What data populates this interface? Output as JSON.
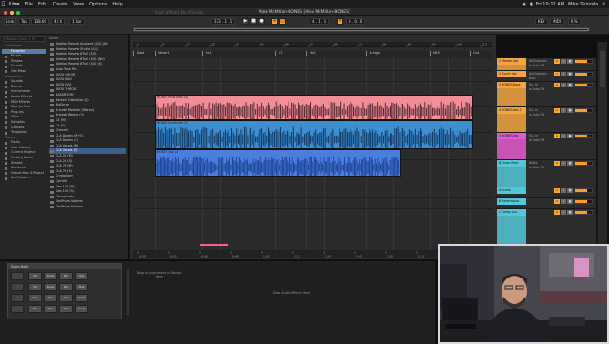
{
  "menubar": {
    "apple": "",
    "items": [
      "Live",
      "File",
      "Edit",
      "Create",
      "View",
      "Options",
      "Help"
    ],
    "clock": "Fri 10:12 AM",
    "user": "Mike Shinoda"
  },
  "window": {
    "title": "Alex McMillan-BONES  [Alex McMillan-BONES]",
    "ghost_title": "Flash Without Me #Serrato"
  },
  "transport": {
    "link": "Link",
    "tap": "Tap",
    "tempo": "138.00",
    "meter": "4 / 4",
    "metro": "1 Bar",
    "position": "233 . 1 . 1",
    "loop_start": "4 . 1 . 1",
    "loop_len": "8 . 0 . 0",
    "key": "KEY",
    "midi": "MIDI",
    "cpu": "6 %"
  },
  "browser": {
    "search_placeholder": "Search (Cmd + F)",
    "column_name": "Name",
    "categories": [
      {
        "label": "Collections",
        "type": "hdr"
      },
      {
        "label": "Favorites",
        "type": "item"
      },
      {
        "label": "Purple",
        "type": "item"
      },
      {
        "label": "Shakes",
        "type": "item"
      },
      {
        "label": "Sounds",
        "type": "item"
      },
      {
        "label": "Use Moon",
        "type": "item"
      },
      {
        "label": "Categories",
        "type": "hdr"
      },
      {
        "label": "Sounds",
        "type": "item"
      },
      {
        "label": "Drums",
        "type": "item"
      },
      {
        "label": "Instruments",
        "type": "item"
      },
      {
        "label": "Audio Effects",
        "type": "item"
      },
      {
        "label": "MIDI Effects",
        "type": "item"
      },
      {
        "label": "Max for Live",
        "type": "item"
      },
      {
        "label": "Plug-ins",
        "type": "item"
      },
      {
        "label": "Clips",
        "type": "item"
      },
      {
        "label": "Samples",
        "type": "item"
      },
      {
        "label": "Grooves",
        "type": "item"
      },
      {
        "label": "Templates",
        "type": "item"
      },
      {
        "label": "Places",
        "type": "hdr"
      },
      {
        "label": "Packs",
        "type": "item"
      },
      {
        "label": "User Library",
        "type": "item"
      },
      {
        "label": "Current Project",
        "type": "item"
      },
      {
        "label": "Factory Packs",
        "type": "item"
      },
      {
        "label": "Shared",
        "type": "item"
      },
      {
        "label": "Seeds Lib",
        "type": "item"
      },
      {
        "label": "Virtual Mac 4 Project",
        "type": "item"
      },
      {
        "label": "Add Folder...",
        "type": "item"
      }
    ],
    "files": [
      {
        "label": "Ableton Reverb Ambient (S/S) (Ne",
        "sel": false
      },
      {
        "label": "Ableton Reverb Studio (S/S)",
        "sel": false
      },
      {
        "label": "Ableton Reverb 8Trail (S/S)",
        "sel": false
      },
      {
        "label": "Ableton Reverb 8Trail (S/S) (Ne)",
        "sel": false
      },
      {
        "label": "Ableton Reverb 8Trail (S/S) (S)",
        "sel": false
      },
      {
        "label": "Auto Tune Pro",
        "sel": false
      },
      {
        "label": "AVOX CHOIR",
        "sel": false
      },
      {
        "label": "AVOX DUO",
        "sel": false
      },
      {
        "label": "AVOX EVO",
        "sel": false
      },
      {
        "label": "AVOX THROAT",
        "sel": false
      },
      {
        "label": "BASSROOM",
        "sel": false
      },
      {
        "label": "Berserk Distortion (S)",
        "sel": false
      },
      {
        "label": "BigDrum",
        "sel": false
      },
      {
        "label": "Bricasti Moduler (Stereo)",
        "sel": false
      },
      {
        "label": "Bricasti Worlds (S)",
        "sel": false
      },
      {
        "label": "C4 (M)",
        "sel": false
      },
      {
        "label": "C4 (S)",
        "sel": false
      },
      {
        "label": "Channel",
        "sel": false
      },
      {
        "label": "CLA Drums (M+S)",
        "sel": false
      },
      {
        "label": "CLA Drums (S)",
        "sel": false
      },
      {
        "label": "CLA Vocals (M)",
        "sel": false
      },
      {
        "label": "CLA Vocals (S)",
        "sel": false
      },
      {
        "label": "CLA 2A (M)",
        "sel": false
      },
      {
        "label": "CLA 2A (S)",
        "sel": false
      },
      {
        "label": "CLA 76 (M)",
        "sel": false
      },
      {
        "label": "CLA 76 (S)",
        "sel": false
      },
      {
        "label": "Crystallizer",
        "sel": false
      },
      {
        "label": "CymVol",
        "sel": false
      },
      {
        "label": "Dec 140 (M)",
        "sel": false
      },
      {
        "label": "Dec 140 (S)",
        "sel": false
      },
      {
        "label": "DecapAudio",
        "sel": false
      },
      {
        "label": "DecPrism Volume",
        "sel": false
      },
      {
        "label": "DecPrism Volume",
        "sel": false
      }
    ],
    "selected_index": 21
  },
  "locators": [
    {
      "label": "Start"
    },
    {
      "label": "Verse 1"
    },
    {
      "label": "Hk1"
    },
    {
      "label": "V2"
    },
    {
      "label": "Hk2"
    },
    {
      "label": "Bridge"
    },
    {
      "label": "Hk3"
    },
    {
      "label": "Out"
    }
  ],
  "ruler_ticks": [
    "1",
    "9",
    "17",
    "25",
    "33",
    "41",
    "49",
    "57",
    "65",
    "73",
    "81",
    "89",
    "97",
    "105",
    "113"
  ],
  "time_ticks": [
    "0:00",
    "0:15",
    "0:30",
    "0:45",
    "1:00",
    "1:15",
    "1:30",
    "1:45",
    "2:00",
    "2:15",
    "2:30",
    "2:45"
  ],
  "clips": [
    {
      "name": "BONES Final Bass (4)",
      "color": "#f18f99"
    },
    {
      "name": "BONES Synth Vox (3)",
      "color": "#3e8fd1"
    },
    {
      "name": "BONES Vox (4)",
      "color": "#4a7dde"
    }
  ],
  "tracks": [
    {
      "name": "1 Master Vox",
      "color": "#f2a540",
      "input": "All Channels",
      "mode": "In Auto Off",
      "vol": "0"
    },
    {
      "name": "2 Synth Vox",
      "color": "#f2a540",
      "input": "All Channels",
      "mode": "Auto",
      "vol": "0"
    },
    {
      "name": "3 BONES Bass",
      "color": "#f2a540",
      "input": "Ext. In",
      "mode": "In Auto Off",
      "vol": "0"
    },
    {
      "name": "4 BONES Vox 2",
      "color": "#f2a540",
      "input": "Ext. In",
      "mode": "In Auto Off",
      "vol": "0"
    },
    {
      "name": "5 BONES Vox",
      "color": "#e35bd0",
      "input": "Ext. In",
      "mode": "In Auto Off",
      "vol": "0"
    },
    {
      "name": "6 Drum Rack",
      "color": "#53c6d8",
      "input": "All Ins",
      "mode": "In Auto Off",
      "vol": "0"
    },
    {
      "name": "A Audio",
      "color": "#53c6d8",
      "input": "",
      "mode": "",
      "vol": "0"
    },
    {
      "name": "B Reverb Aux",
      "color": "#53c6d8",
      "input": "",
      "mode": "",
      "vol": "0"
    },
    {
      "name": "C Delay Aux",
      "color": "#53c6d8",
      "input": "",
      "mode": "",
      "vol": "0"
    }
  ],
  "detail": {
    "rack_title": "Drum Rack",
    "drop_hint": "Drop an Instrument or Sample Here",
    "fx_hint": "Drop Audio Effects Here",
    "pads": [
      "Hat",
      "Snare",
      "Kick",
      "Clap",
      "Hat",
      "Snare",
      "Kick",
      "Clap",
      "Perc",
      "Tom",
      "Rim",
      "Crash",
      "Perc",
      "Tom",
      "Rim",
      "Crash"
    ]
  },
  "colors": {
    "accent": "#ff9c2a",
    "pink_clip": "#f18f99",
    "blue_clip": "#3e8fd1",
    "selection": "#5a7aa7"
  }
}
